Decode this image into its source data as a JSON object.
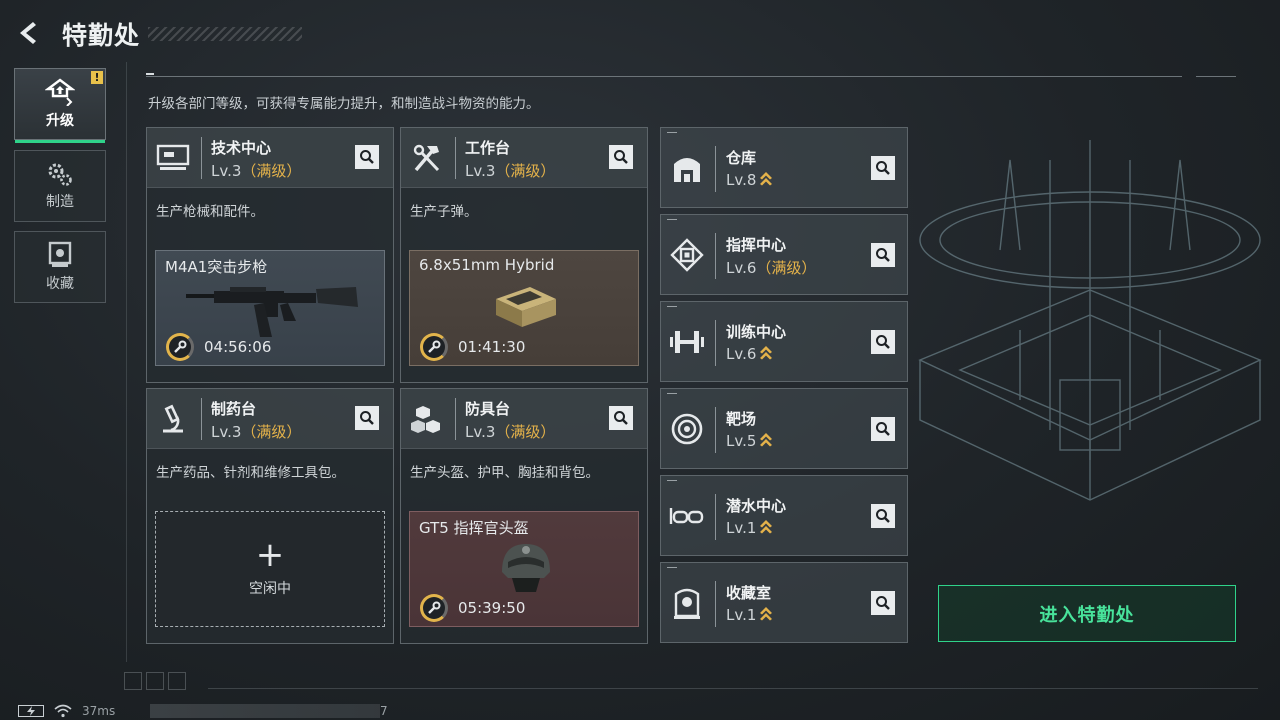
{
  "header": {
    "title": "特勤处",
    "description": "升级各部门等级，可获得专属能力提升，和制造战斗物资的能力。"
  },
  "sidebar": {
    "tabs": [
      {
        "label": "升级",
        "icon": "upgrade-icon",
        "active": true,
        "badge": "!"
      },
      {
        "label": "制造",
        "icon": "gears-icon",
        "active": false
      },
      {
        "label": "收藏",
        "icon": "collection-icon",
        "active": false
      }
    ]
  },
  "facilities": [
    {
      "name": "技术中心",
      "level": "Lv.3",
      "max_label": "（满级）",
      "description": "生产枪械和配件。",
      "production": {
        "item": "M4A1突击步枪",
        "timer": "04:56:06"
      }
    },
    {
      "name": "工作台",
      "level": "Lv.3",
      "max_label": "（满级）",
      "description": "生产子弹。",
      "production": {
        "item": "6.8x51mm Hybrid",
        "timer": "01:41:30"
      }
    },
    {
      "name": "制药台",
      "level": "Lv.3",
      "max_label": "（满级）",
      "description": "生产药品、针剂和维修工具包。",
      "production": {
        "idle_icon": "+",
        "idle_label": "空闲中"
      }
    },
    {
      "name": "防具台",
      "level": "Lv.3",
      "max_label": "（满级）",
      "description": "生产头盔、护甲、胸挂和背包。",
      "production": {
        "item": "GT5 指挥官头盔",
        "timer": "05:39:50"
      }
    }
  ],
  "mini_facilities": [
    {
      "name": "仓库",
      "level": "Lv.8",
      "max_label": "",
      "icon": "warehouse-icon"
    },
    {
      "name": "指挥中心",
      "level": "Lv.6",
      "max_label": "（满级）",
      "icon": "chip-icon"
    },
    {
      "name": "训练中心",
      "level": "Lv.6",
      "max_label": "",
      "icon": "dumbbell-icon"
    },
    {
      "name": "靶场",
      "level": "Lv.5",
      "max_label": "",
      "icon": "target-icon"
    },
    {
      "name": "潜水中心",
      "level": "Lv.1",
      "max_label": "",
      "icon": "goggles-icon"
    },
    {
      "name": "收藏室",
      "level": "Lv.1",
      "max_label": "",
      "icon": "collection-icon"
    }
  ],
  "enter_button": {
    "label": "进入特勤处"
  },
  "status_bar": {
    "ping": "37ms",
    "number": "7"
  },
  "colors": {
    "accent_green": "#2fd38a",
    "max_gold": "#e4b24a"
  }
}
